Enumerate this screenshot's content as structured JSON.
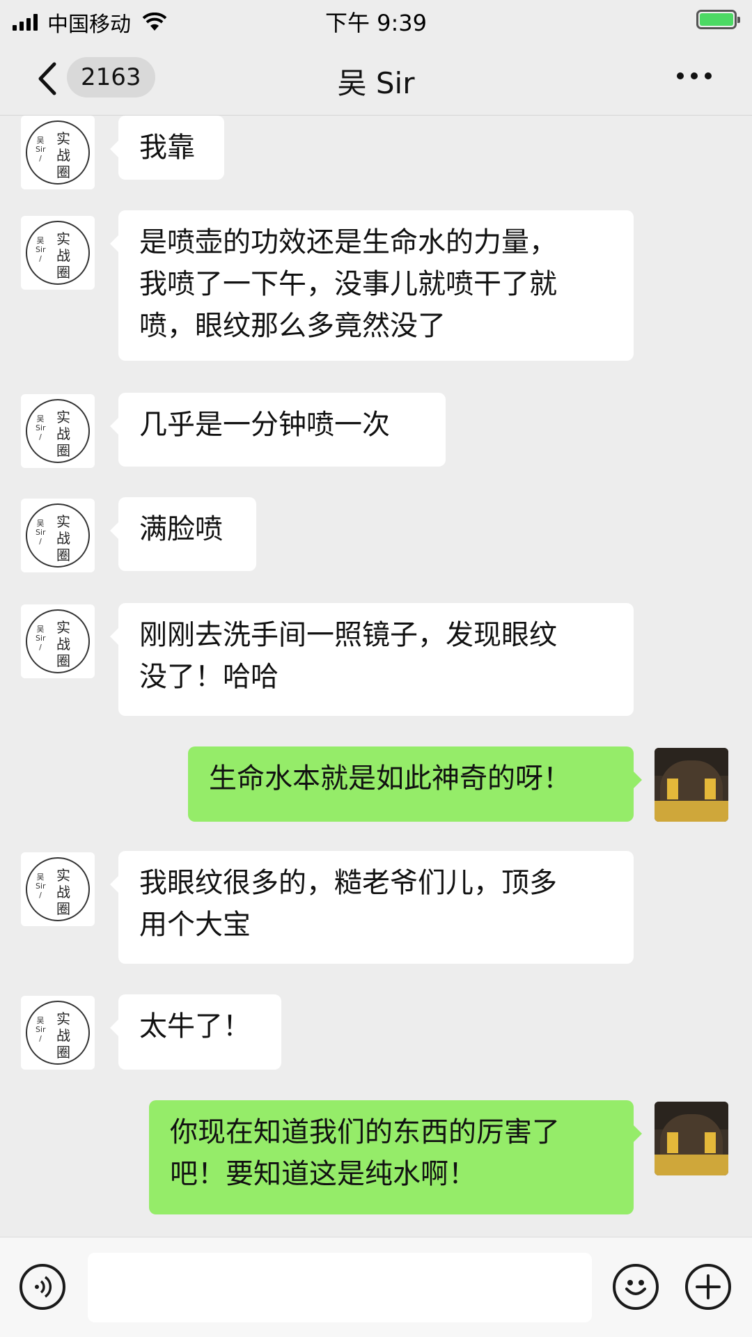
{
  "status_bar": {
    "carrier": "中国移动",
    "time": "下午 9:39",
    "battery_level": 1.0,
    "battery_color": "#4cd964",
    "icons": [
      "signal-icon",
      "wifi-icon",
      "battery-icon"
    ]
  },
  "nav": {
    "unread_count": "2163",
    "title": "吴 Sir",
    "icons": [
      "back-chevron-icon",
      "more-dots-icon"
    ]
  },
  "contact_avatar": {
    "small_text": "吴 Sir /",
    "big_text": "实战圈"
  },
  "messages": [
    {
      "side": "left",
      "text": "我靠"
    },
    {
      "side": "left",
      "text": "是喷壶的功效还是生命水的力量，\n我喷了一下午，没事儿就喷干了就\n喷，眼纹那么多竟然没了"
    },
    {
      "side": "left",
      "text": "几乎是一分钟喷一次"
    },
    {
      "side": "left",
      "text": "满脸喷"
    },
    {
      "side": "left",
      "text": "刚刚去洗手间一照镜子，发现眼纹\n没了！哈哈"
    },
    {
      "side": "right",
      "text": "生命水本就是如此神奇的呀！"
    },
    {
      "side": "left",
      "text": "我眼纹很多的，糙老爷们儿，顶多\n用个大宝"
    },
    {
      "side": "left",
      "text": "太牛了！"
    },
    {
      "side": "right",
      "text": "你现在知道我们的东西的厉害了\n吧！要知道这是纯水啊！"
    }
  ],
  "input_bar": {
    "placeholder": "",
    "icons": [
      "voice-icon",
      "emoji-icon",
      "plus-icon"
    ]
  },
  "colors": {
    "background": "#ededed",
    "bubble_incoming": "#ffffff",
    "bubble_outgoing": "#95ec69"
  }
}
